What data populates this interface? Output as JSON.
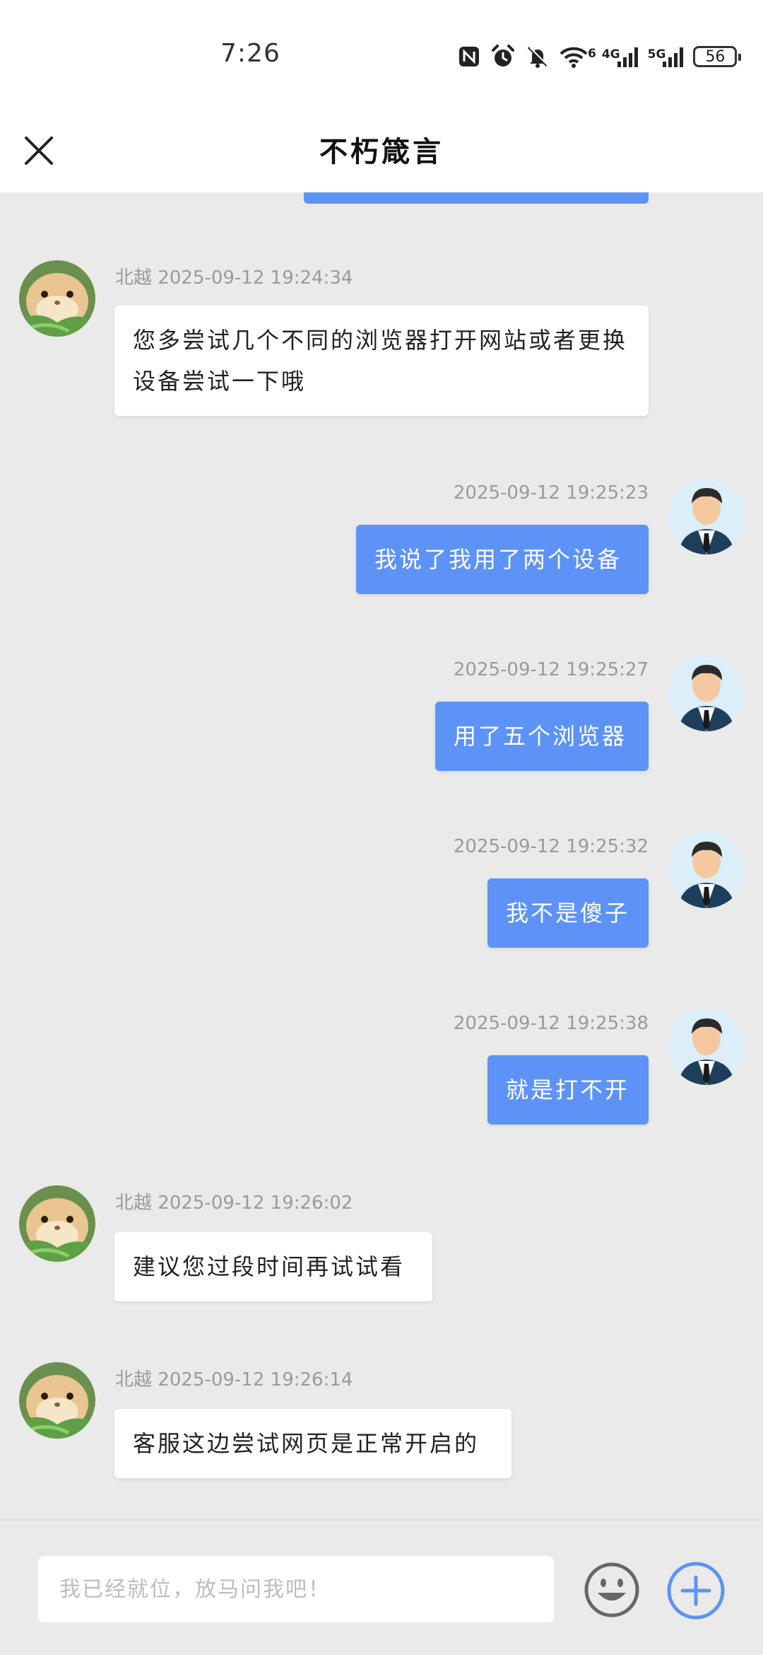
{
  "status_bar": {
    "time": "7:26",
    "wifi_label": "6",
    "net1_label": "4G",
    "net2_label": "5G",
    "battery_level": "56"
  },
  "header": {
    "title": "不朽箴言",
    "close_icon": "close-icon"
  },
  "messages": [
    {
      "side": "in",
      "sender": "北越",
      "time": "2025-09-12 19:24:34",
      "text": "您多尝试几个不同的浏览器打开网站或者更换设备尝试一下哦",
      "avatar": "hamster-avatar"
    },
    {
      "side": "out",
      "time": "2025-09-12 19:25:23",
      "text": "我说了我用了两个设备",
      "avatar": "user-avatar"
    },
    {
      "side": "out",
      "time": "2025-09-12 19:25:27",
      "text": "用了五个浏览器",
      "avatar": "user-avatar"
    },
    {
      "side": "out",
      "time": "2025-09-12 19:25:32",
      "text": "我不是傻子",
      "avatar": "user-avatar"
    },
    {
      "side": "out",
      "time": "2025-09-12 19:25:38",
      "text": "就是打不开",
      "avatar": "user-avatar"
    },
    {
      "side": "in",
      "sender": "北越",
      "time": "2025-09-12 19:26:02",
      "text": "建议您过段时间再试试看",
      "avatar": "hamster-avatar"
    },
    {
      "side": "in",
      "sender": "北越",
      "time": "2025-09-12 19:26:14",
      "text": "客服这边尝试网页是正常开启的",
      "avatar": "hamster-avatar"
    }
  ],
  "input": {
    "placeholder": "我已经就位，放马问我吧！",
    "value": ""
  },
  "colors": {
    "accent": "#5d93f7",
    "background": "#eaeaea",
    "bubble_in": "#ffffff"
  }
}
